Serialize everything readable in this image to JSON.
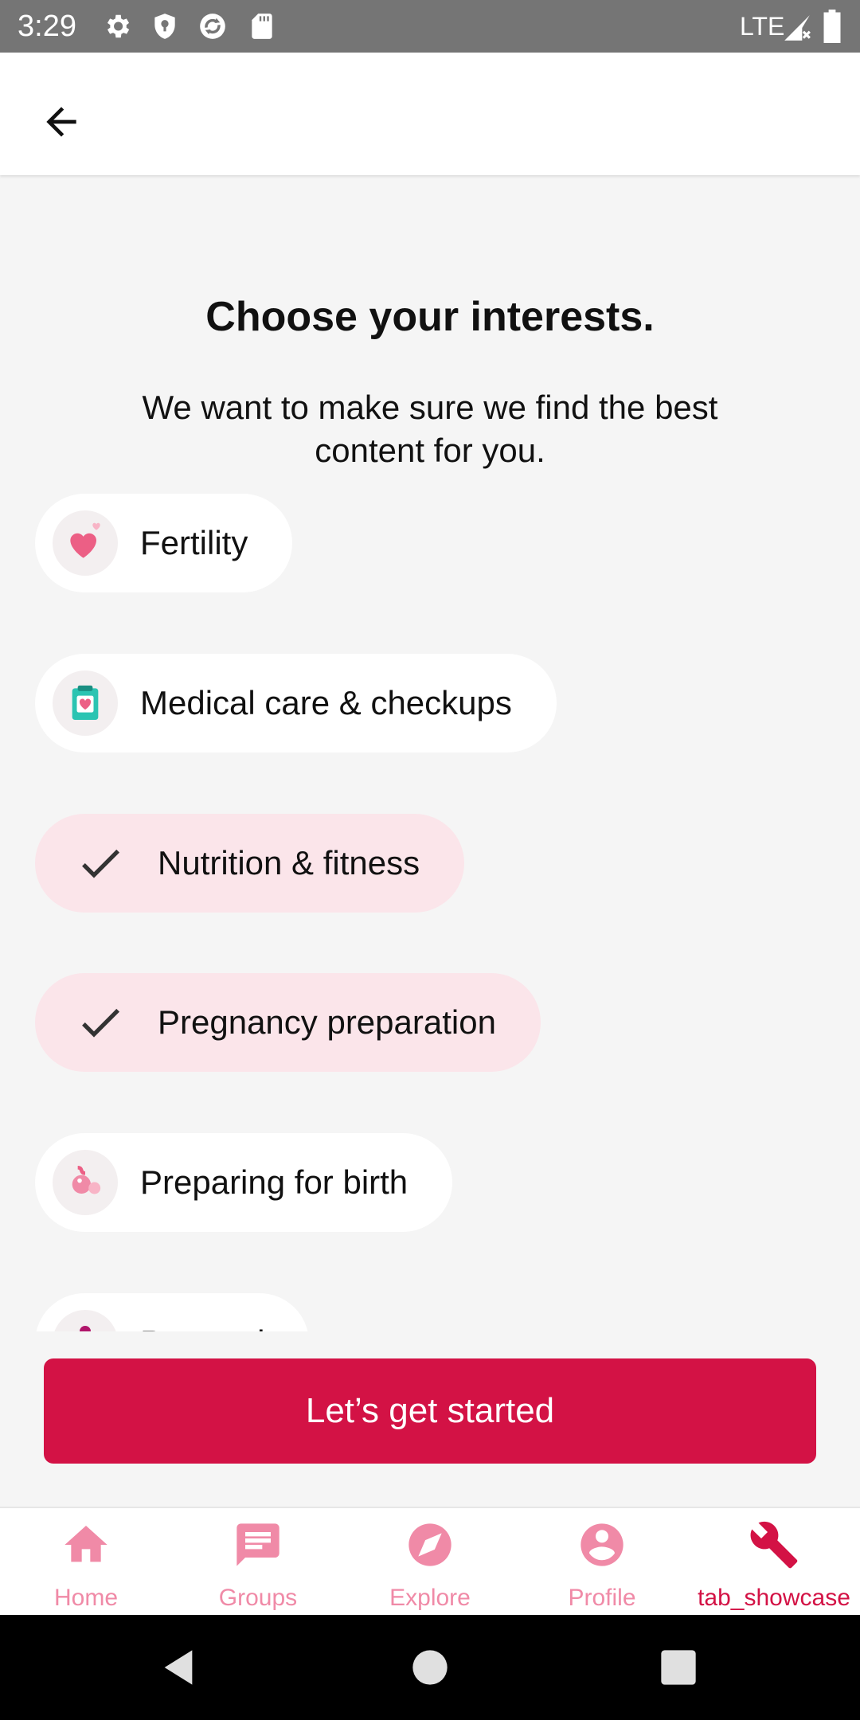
{
  "status_bar": {
    "time": "3:29",
    "network": "LTE",
    "icons": [
      "gear-icon",
      "shield-icon",
      "sync-icon",
      "sd-card-icon",
      "signal-icon",
      "battery-icon"
    ]
  },
  "app_bar": {
    "back_icon": "back-arrow-icon"
  },
  "main": {
    "title": "Choose your interests.",
    "subtitle": "We want to make sure we find the best content for you.",
    "interests": [
      {
        "label": "Fertility",
        "selected": false,
        "icon": "heart-icon"
      },
      {
        "label": "Medical care & checkups",
        "selected": false,
        "icon": "medical-card-icon"
      },
      {
        "label": "Nutrition & fitness",
        "selected": true,
        "icon": "check-icon"
      },
      {
        "label": "Pregnancy preparation",
        "selected": true,
        "icon": "check-icon"
      },
      {
        "label": "Preparing for birth",
        "selected": false,
        "icon": "baby-icon"
      },
      {
        "label": "Parental",
        "selected": false,
        "icon": "pacifier-icon"
      }
    ],
    "cta_label": "Let’s get started"
  },
  "bottom_nav": {
    "items": [
      {
        "label": "Home",
        "icon": "home-icon",
        "active": false
      },
      {
        "label": "Groups",
        "icon": "chat-icon",
        "active": false
      },
      {
        "label": "Explore",
        "icon": "compass-icon",
        "active": false
      },
      {
        "label": "Profile",
        "icon": "person-icon",
        "active": false
      },
      {
        "label": "tab_showcase",
        "icon": "wrench-icon",
        "active": true
      }
    ]
  },
  "colors": {
    "accent": "#d31245",
    "nav_inactive": "#f08aa7",
    "chip_selected": "#fbe5ea",
    "background": "#f5f5f5"
  }
}
